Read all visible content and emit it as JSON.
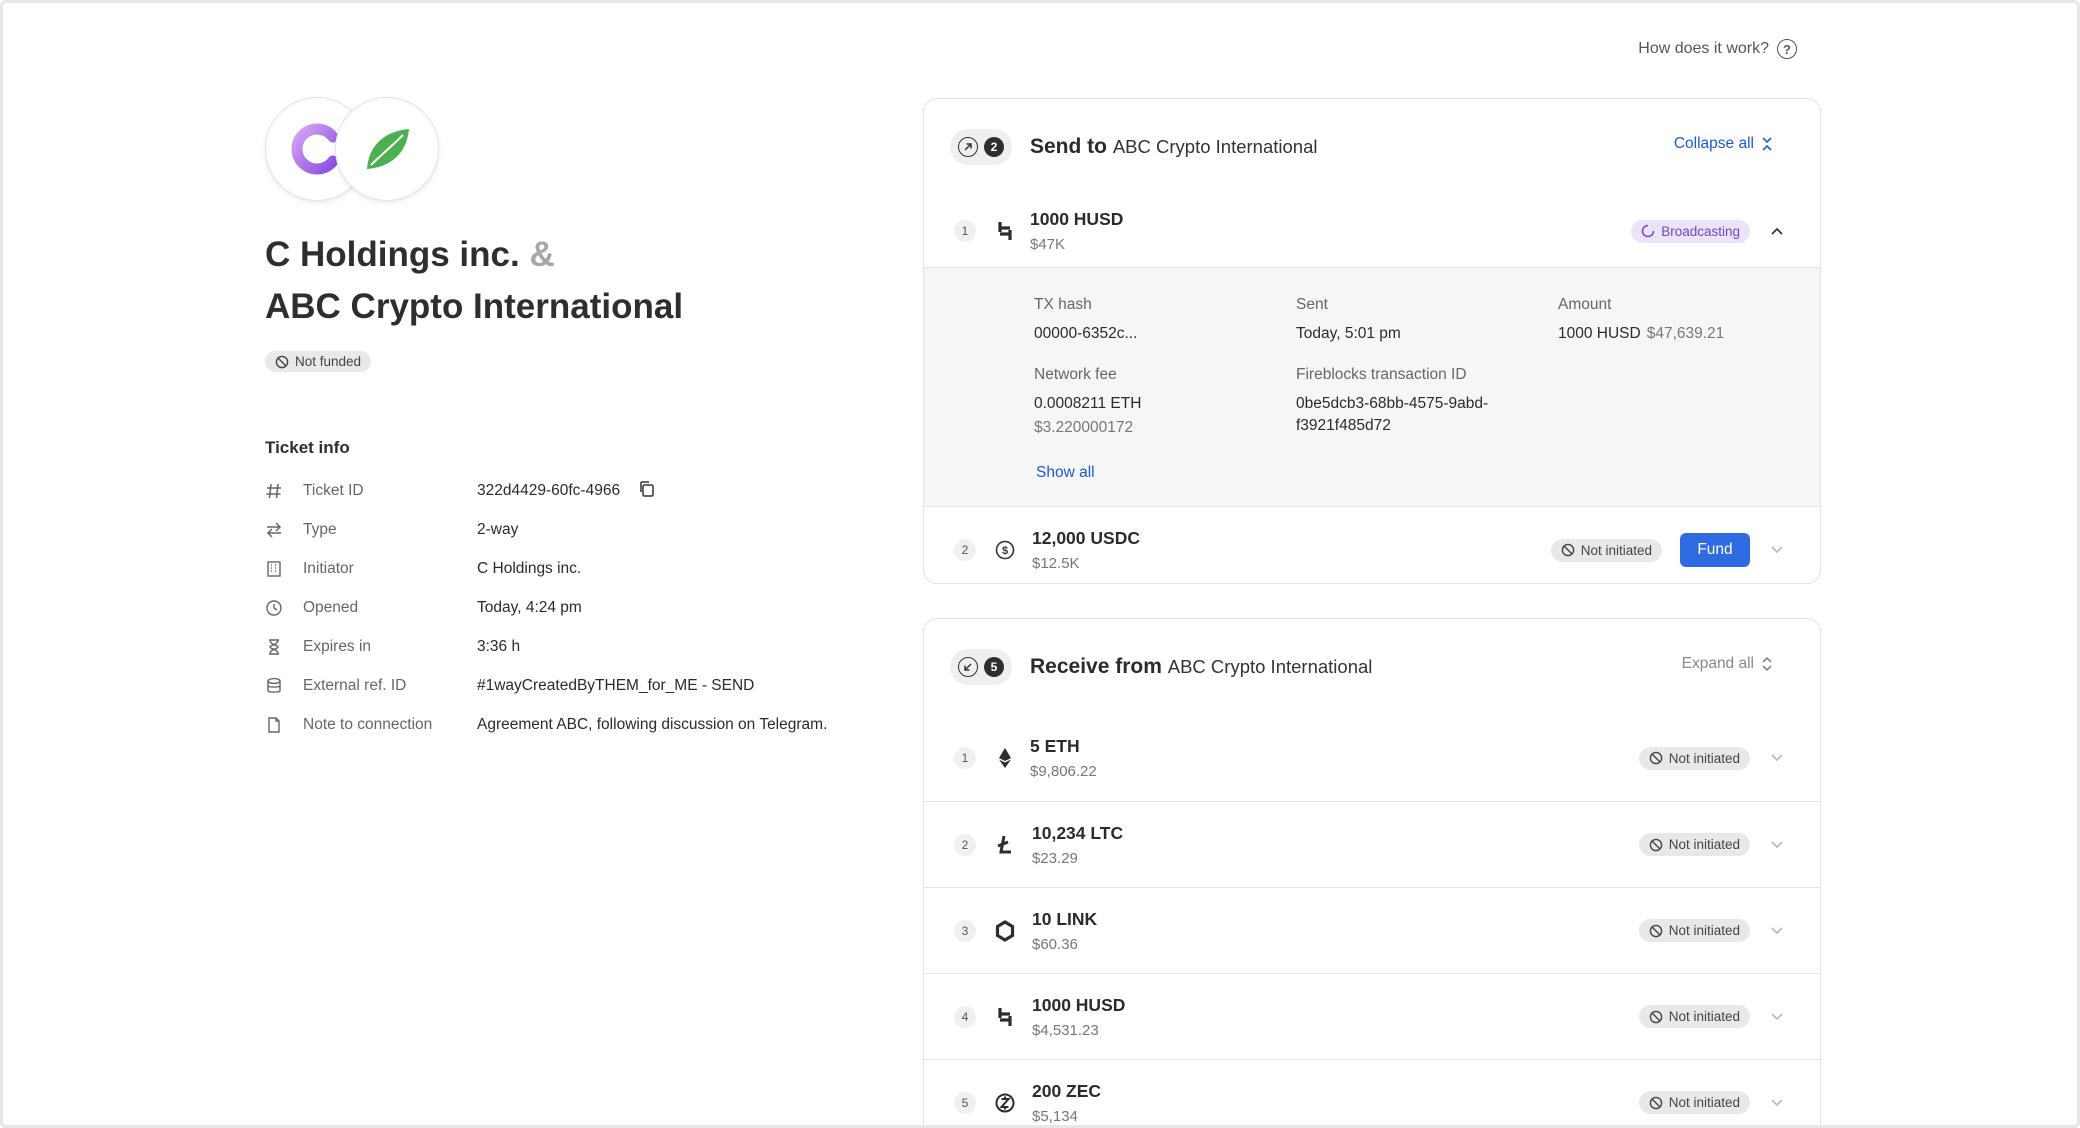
{
  "help_link": {
    "label": "How does it work?"
  },
  "counterparty": {
    "from_name": "C Holdings inc.",
    "amp": "&",
    "to_name": "ABC Crypto International",
    "funding_status": "Not funded"
  },
  "ticket_info": {
    "heading": "Ticket info",
    "rows": [
      {
        "icon": "hash-icon",
        "label": "Ticket ID",
        "value": "322d4429-60fc-4966"
      },
      {
        "icon": "swap-icon",
        "label": "Type",
        "value": "2-way"
      },
      {
        "icon": "building-icon",
        "label": "Initiator",
        "value": "C Holdings inc."
      },
      {
        "icon": "clock-icon",
        "label": "Opened",
        "value": "Today, 4:24 pm"
      },
      {
        "icon": "hourglass-icon",
        "label": "Expires in",
        "value": "3:36 h"
      },
      {
        "icon": "database-icon",
        "label": "External ref. ID",
        "value": "#1wayCreatedByTHEM_for_ME - SEND"
      },
      {
        "icon": "document-icon",
        "label": "Note to connection",
        "value": "Agreement ABC, following discussion on Telegram."
      }
    ]
  },
  "send": {
    "count": "2",
    "title": "Send to",
    "party": "ABC Crypto International",
    "toggle_label": "Collapse all",
    "items": [
      {
        "num": "1",
        "coin": "husd-icon",
        "amount": "1000 HUSD",
        "usd": "$47K",
        "status": "Broadcasting"
      },
      {
        "num": "2",
        "coin": "usdc-icon",
        "amount": "12,000 USDC",
        "usd": "$12.5K",
        "status": "Not initiated",
        "action": "Fund"
      }
    ],
    "details": {
      "tx_hash_label": "TX hash",
      "tx_hash": "00000-6352c...",
      "sent_label": "Sent",
      "sent": "Today, 5:01 pm",
      "amount_label": "Amount",
      "amount": "1000 HUSD",
      "amount_usd": "$47,639.21",
      "fee_label": "Network fee",
      "fee": "0.0008211 ETH",
      "fee_usd": "$3.220000172",
      "fb_label": "Fireblocks transaction ID",
      "fb_line1": "0be5dcb3-68bb-4575-9abd-",
      "fb_line2": "f3921f485d72",
      "show_all": "Show all"
    }
  },
  "receive": {
    "count": "5",
    "title": "Receive from",
    "party": "ABC Crypto International",
    "toggle_label": "Expand all",
    "items": [
      {
        "num": "1",
        "coin": "eth-icon",
        "amount": "5 ETH",
        "usd": "$9,806.22",
        "status": "Not initiated"
      },
      {
        "num": "2",
        "coin": "ltc-icon",
        "amount": "10,234 LTC",
        "usd": "$23.29",
        "status": "Not initiated"
      },
      {
        "num": "3",
        "coin": "link-icon",
        "amount": "10 LINK",
        "usd": "$60.36",
        "status": "Not initiated"
      },
      {
        "num": "4",
        "coin": "husd-icon",
        "amount": "1000 HUSD",
        "usd": "$4,531.23",
        "status": "Not initiated"
      },
      {
        "num": "5",
        "coin": "zec-icon",
        "amount": "200 ZEC",
        "usd": "$5,134",
        "status": "Not initiated"
      }
    ]
  },
  "colors": {
    "accent": "#2f6be0",
    "link": "#1a5ad7",
    "broadcasting_bg": "#ece3fb",
    "broadcasting_text": "#7147c9"
  }
}
